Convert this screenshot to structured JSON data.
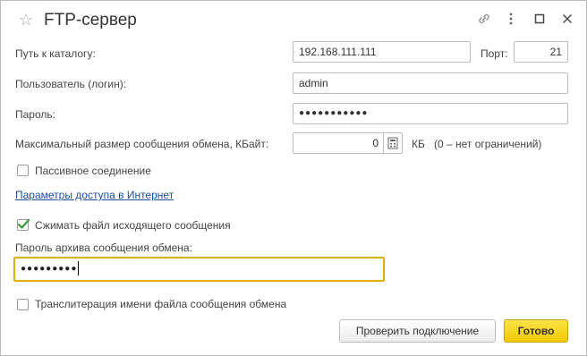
{
  "window": {
    "title": "FTP-сервер",
    "icons": [
      "star-icon",
      "link-icon",
      "more-icon",
      "maximize-icon",
      "close-icon"
    ]
  },
  "form": {
    "path_label": "Путь к каталогу:",
    "path_value": "192.168.111.111",
    "port_label": "Порт:",
    "port_value": "21",
    "user_label": "Пользователь (логин):",
    "user_value": "admin",
    "password_label": "Пароль:",
    "password_value": "●●●●●●●●●●●",
    "maxsize_label": "Максимальный размер сообщения обмена, КБайт:",
    "maxsize_value": "0",
    "maxsize_unit": "КБ",
    "maxsize_hint": "(0 – нет ограничений)",
    "passive_label": "Пассивное соединение",
    "passive_checked": false,
    "internet_link": "Параметры доступа в Интернет",
    "compress_label": "Сжимать файл исходящего сообщения",
    "compress_checked": true,
    "archive_pwd_label": "Пароль архива сообщения обмена:",
    "archive_pwd_value": "●●●●●●●●●",
    "translit_label": "Транслитерация имени файла сообщения обмена",
    "translit_checked": false
  },
  "buttons": {
    "check": "Проверить подключение",
    "done": "Готово"
  },
  "colors": {
    "accent_yellow": "#f5d000",
    "focus_border": "#e0b100",
    "link": "#1a4fa0",
    "check_green": "#3a9a3a"
  }
}
